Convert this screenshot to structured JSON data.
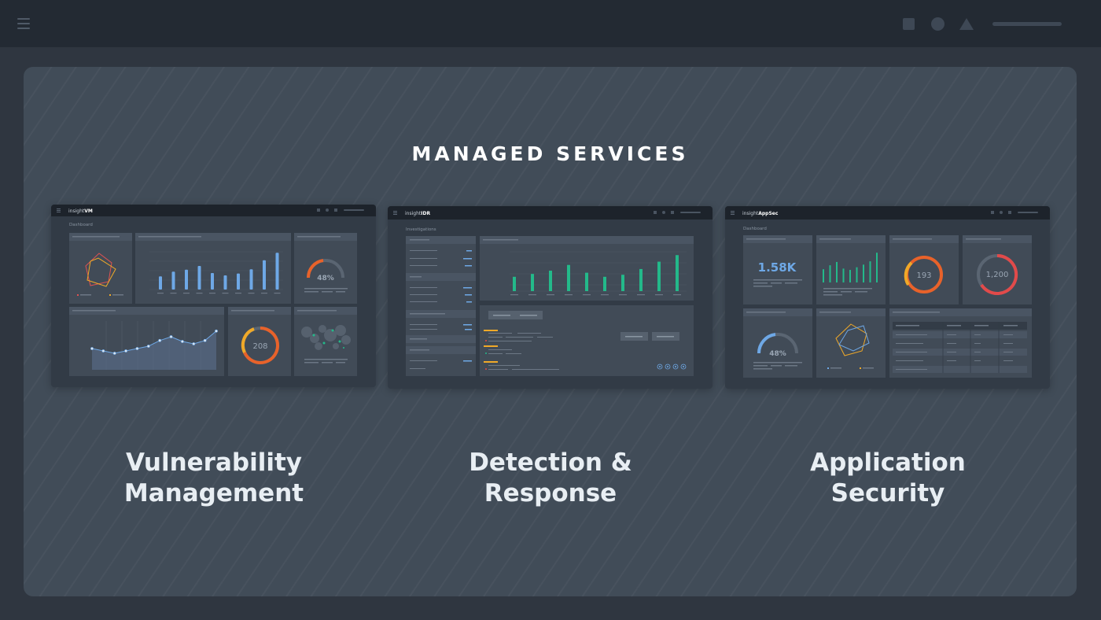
{
  "header": {
    "icons": [
      "menu-icon",
      "square-icon",
      "circle-icon",
      "triangle-icon"
    ]
  },
  "main": {
    "title": "MANAGED SERVICES"
  },
  "cards": [
    {
      "brand_prefix": "insight",
      "brand_suffix": "VM",
      "page_title": "Dashboard",
      "gauge_value": "48%",
      "donut_value": "208",
      "label_line1": "Vulnerability",
      "label_line2": "Management",
      "bars": [
        0.28,
        0.38,
        0.42,
        0.5,
        0.35,
        0.3,
        0.34,
        0.43,
        0.62,
        0.78
      ],
      "line": [
        0.45,
        0.4,
        0.35,
        0.4,
        0.45,
        0.5,
        0.62,
        0.7,
        0.6,
        0.55,
        0.62,
        0.82
      ]
    },
    {
      "brand_prefix": "insight",
      "brand_suffix": "IDR",
      "page_title": "Investigations",
      "label_line1": "Detection &",
      "label_line2": "Response",
      "bars": [
        0.35,
        0.42,
        0.5,
        0.64,
        0.45,
        0.35,
        0.4,
        0.54,
        0.72,
        0.88
      ]
    },
    {
      "brand_prefix": "insight",
      "brand_suffix": "AppSec",
      "page_title": "Dashboard",
      "kpi_value": "1.58K",
      "donut_value": "193",
      "donut_value_2": "1,200",
      "gauge_value": "48%",
      "label_line1": "Application",
      "label_line2": "Security",
      "bars": [
        0.4,
        0.52,
        0.62,
        0.42,
        0.38,
        0.46,
        0.54,
        0.64,
        0.9
      ]
    }
  ],
  "colors": {
    "page_bg": "#2f3640",
    "topbar_bg": "#232a33",
    "panel_bg": "#414c58",
    "accent_blue": "#6ea8e6",
    "accent_green": "#23b98a",
    "accent_orange": "#e8622a",
    "accent_yellow": "#f0a928",
    "accent_red": "#e24a4a"
  }
}
